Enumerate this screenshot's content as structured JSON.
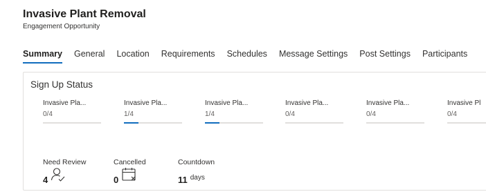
{
  "header": {
    "title": "Invasive Plant Removal",
    "subtitle": "Engagement Opportunity"
  },
  "tabs": [
    {
      "label": "Summary",
      "active": true
    },
    {
      "label": "General",
      "active": false
    },
    {
      "label": "Location",
      "active": false
    },
    {
      "label": "Requirements",
      "active": false
    },
    {
      "label": "Schedules",
      "active": false
    },
    {
      "label": "Message Settings",
      "active": false
    },
    {
      "label": "Post Settings",
      "active": false
    },
    {
      "label": "Participants",
      "active": false
    }
  ],
  "signup_status": {
    "title": "Sign Up Status",
    "items": [
      {
        "name": "Invasive Pla...",
        "count": "0/4",
        "fill_fraction": 0
      },
      {
        "name": "Invasive Pla...",
        "count": "1/4",
        "fill_fraction": 0.25
      },
      {
        "name": "Invasive Pla...",
        "count": "1/4",
        "fill_fraction": 0.25
      },
      {
        "name": "Invasive Pla...",
        "count": "0/4",
        "fill_fraction": 0
      },
      {
        "name": "Invasive Pla...",
        "count": "0/4",
        "fill_fraction": 0
      },
      {
        "name": "Invasive Pl",
        "count": "0/4",
        "fill_fraction": 0
      }
    ]
  },
  "metrics": {
    "need_review": {
      "label": "Need Review",
      "value": "4",
      "icon": "person-check-icon"
    },
    "cancelled": {
      "label": "Cancelled",
      "value": "0",
      "icon": "calendar-cancel-icon"
    },
    "countdown": {
      "label": "Countdown",
      "value": "11",
      "unit": "days"
    }
  },
  "colors": {
    "accent": "#0f6cbd",
    "track": "#e1dfdd"
  }
}
